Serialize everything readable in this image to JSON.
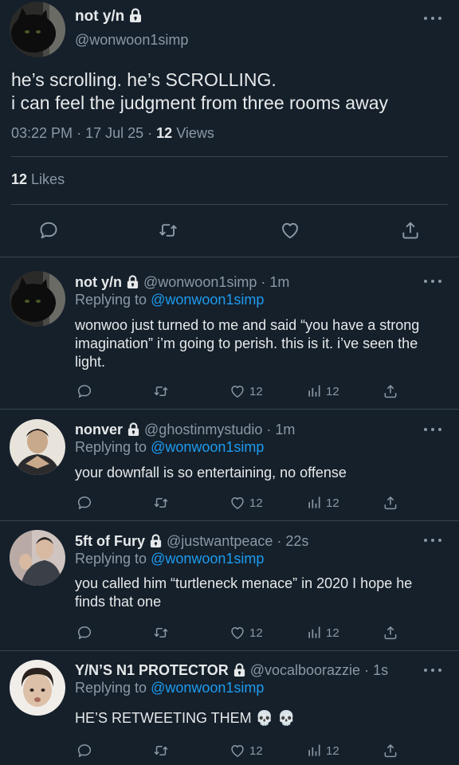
{
  "main_tweet": {
    "name": "not y/n",
    "handle": "@wonwoon1simp",
    "text_lines": [
      "he’s scrolling. he’s SCROLLING.",
      "i can feel the judgment from three rooms away"
    ],
    "time": "03:22 PM",
    "date": "17 Jul 25",
    "views_count": "12",
    "views_label": "Views",
    "likes_count": "12",
    "likes_label": "Likes",
    "actions": [
      "reply-icon",
      "retweet-icon",
      "like-icon",
      "share-icon"
    ]
  },
  "replies": [
    {
      "name": "not y/n",
      "handle": "@wonwoon1simp",
      "time": "1m",
      "replying_label": "Replying to",
      "replying_to": "@wonwoon1simp",
      "text": "wonwoo just turned to me and said “you have a strong imagination” i’m going to perish. this is it. i’ve seen the light.",
      "likes": "12",
      "views": "12"
    },
    {
      "name": "nonver",
      "handle": "@ghostinmystudio",
      "time": "1m",
      "replying_label": "Replying to",
      "replying_to": "@wonwoon1simp",
      "text": "your downfall is so entertaining, no offense",
      "likes": "12",
      "views": "12"
    },
    {
      "name": "5ft of Fury",
      "handle": "@justwantpeace",
      "time": "22s",
      "replying_label": "Replying to",
      "replying_to": "@wonwoon1simp",
      "text": "you called him “turtleneck menace” in 2020 I hope he finds that one",
      "likes": "12",
      "views": "12"
    },
    {
      "name": "Y/N’S N1 PROTECTOR",
      "handle": "@vocalboorazzie",
      "time": "1s",
      "replying_label": "Replying to",
      "replying_to": "@wonwoon1simp",
      "text": "HE’S RETWEETING THEM 💀 💀",
      "likes": "12",
      "views": "12"
    }
  ],
  "colors": {
    "background": "#15202b",
    "text": "#e7e9ea",
    "muted": "#8b98a5",
    "link": "#1d9bf0",
    "divider": "#38444d"
  }
}
